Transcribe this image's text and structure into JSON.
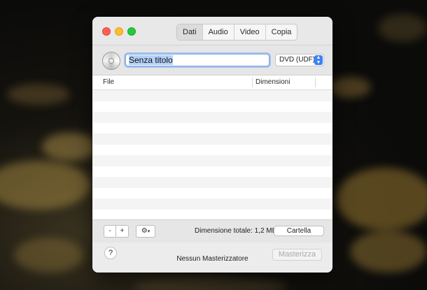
{
  "window": {
    "tabs": [
      {
        "label": "Dati",
        "active": true
      },
      {
        "label": "Audio",
        "active": false
      },
      {
        "label": "Video",
        "active": false
      },
      {
        "label": "Copia",
        "active": false
      }
    ]
  },
  "header": {
    "disc_icon": "cd-disc-icon",
    "title_value": "Senza titolo",
    "format_value": "DVD (UDF)"
  },
  "table": {
    "columns": [
      "File",
      "Dimensioni"
    ],
    "rows": []
  },
  "toolbar": {
    "remove_label": "-",
    "add_label": "+",
    "action_icon": "gear-icon",
    "total_size": "Dimensione totale: 1,2 MB",
    "folder_label": "Cartella"
  },
  "footer": {
    "help_label": "?",
    "status": "Nessun Masterizzatore",
    "burn_label": "Masterizza"
  },
  "colors": {
    "close": "#fe5f57",
    "minimize": "#febc2e",
    "maximize": "#28c840",
    "accent": "#3b82f6",
    "selection": "#b4d2f9"
  }
}
